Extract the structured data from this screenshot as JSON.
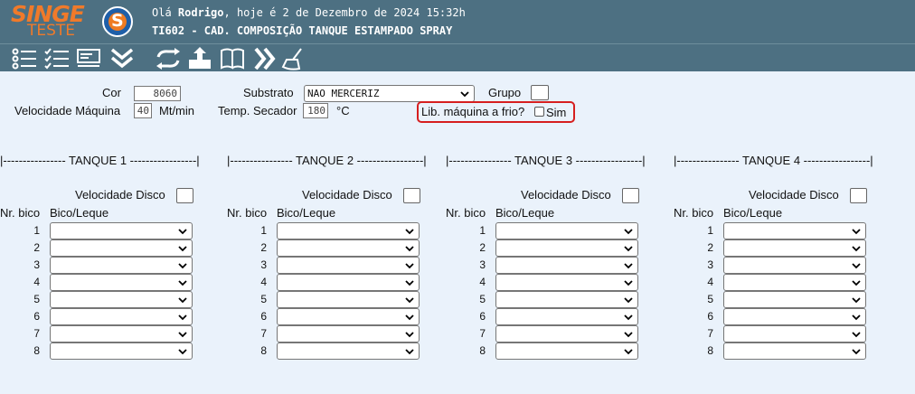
{
  "header": {
    "logo_top": "SINGE",
    "logo_bottom": "TESTE",
    "logo_badge": "S",
    "greeting_prefix": "Olá",
    "user": "Rodrigo",
    "greeting_suffix": ", hoje é 2 de Dezembro de 2024 15:32h",
    "title": "TI602 - CAD. COMPOSIÇÃO TANQUE ESTAMPADO SPRAY"
  },
  "toolbar": {
    "icons": [
      "list-icon",
      "checklist-icon",
      "form-icon",
      "double-chevron-down-icon",
      "refresh-icon",
      "export-icon",
      "book-icon",
      "next-icon",
      "clear-icon"
    ]
  },
  "form": {
    "cor_label": "Cor",
    "cor_value": "8060",
    "velocidade_label": "Velocidade Máquina",
    "velocidade_value": "40",
    "velocidade_unit": "Mt/min",
    "substrato_label": "Substrato",
    "substrato_value": "NAO MERCERIZ",
    "temp_label": "Temp. Secador",
    "temp_value": "180",
    "temp_unit": "°C",
    "grupo_label": "Grupo",
    "lib_label": "Lib. máquina a frio?",
    "lib_option": "Sim"
  },
  "tanks": [
    {
      "header": "|---------------- TANQUE 1 -----------------|",
      "velocidade_disco_label": "Velocidade Disco",
      "nr_bico_label": "Nr. bico",
      "bico_leque_label": "Bico/Leque",
      "rows": [
        "1",
        "2",
        "3",
        "4",
        "5",
        "6",
        "7",
        "8"
      ]
    },
    {
      "header": "|---------------- TANQUE 2 -----------------|",
      "velocidade_disco_label": "Velocidade Disco",
      "nr_bico_label": "Nr. bico",
      "bico_leque_label": "Bico/Leque",
      "rows": [
        "1",
        "2",
        "3",
        "4",
        "5",
        "6",
        "7",
        "8"
      ]
    },
    {
      "header": "|---------------- TANQUE 3 -----------------|",
      "velocidade_disco_label": "Velocidade Disco",
      "nr_bico_label": "Nr. bico",
      "bico_leque_label": "Bico/Leque",
      "rows": [
        "1",
        "2",
        "3",
        "4",
        "5",
        "6",
        "7",
        "8"
      ]
    },
    {
      "header": "|---------------- TANQUE 4 -----------------|",
      "velocidade_disco_label": "Velocidade Disco",
      "nr_bico_label": "Nr. bico",
      "bico_leque_label": "Bico/Leque",
      "rows": [
        "1",
        "2",
        "3",
        "4",
        "5",
        "6",
        "7",
        "8"
      ]
    }
  ],
  "colors": {
    "header_bg": "#4d7082",
    "page_bg": "#eaf2fb",
    "logo_orange": "#f07a2a",
    "highlight_red": "#d61f1f"
  }
}
